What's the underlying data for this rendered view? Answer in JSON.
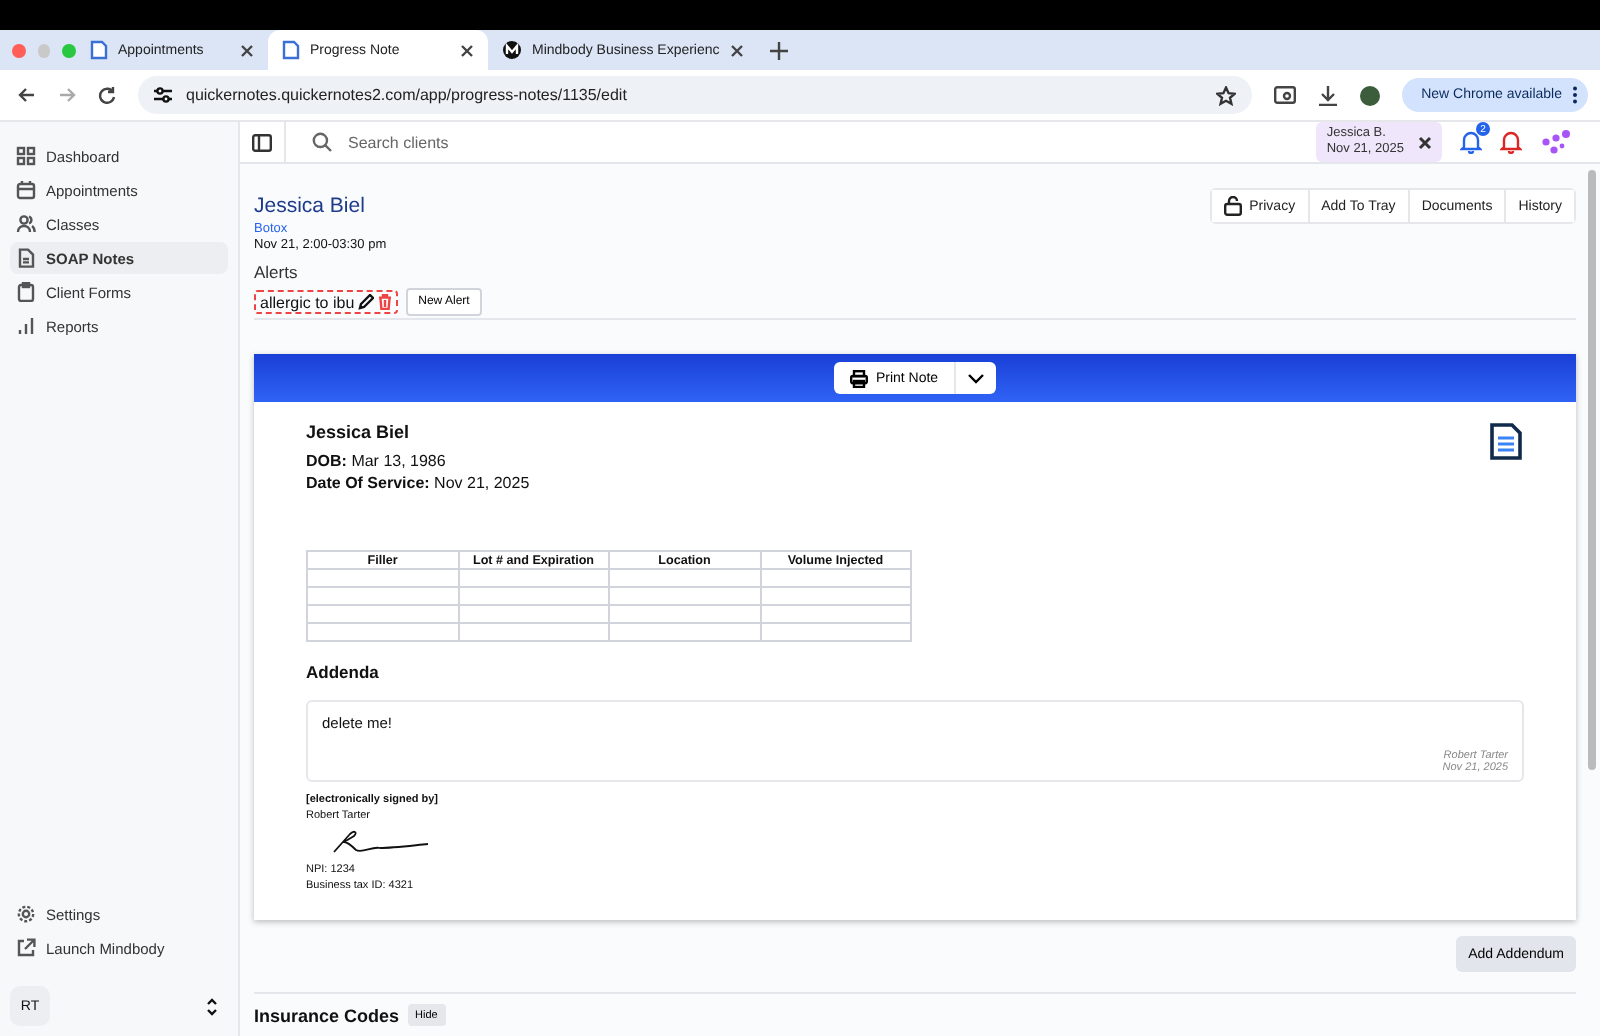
{
  "browser": {
    "tabs": [
      {
        "title": "Appointments",
        "selected": false
      },
      {
        "title": "Progress Note",
        "selected": true
      },
      {
        "title": "Mindbody Business Experienc",
        "selected": false
      }
    ],
    "url": "quickernotes.quickernotes2.com/app/progress-notes/1135/edit",
    "update_button": "New Chrome available"
  },
  "sidebar": {
    "items": [
      {
        "label": "Dashboard",
        "selected": false
      },
      {
        "label": "Appointments",
        "selected": false
      },
      {
        "label": "Classes",
        "selected": false
      },
      {
        "label": "SOAP Notes",
        "selected": true
      },
      {
        "label": "Client Forms",
        "selected": false
      },
      {
        "label": "Reports",
        "selected": false
      }
    ],
    "footer_items": [
      "Settings",
      "Launch Mindbody"
    ],
    "user_initials": "RT"
  },
  "header": {
    "search": {
      "placeholder": "Search clients"
    },
    "tray_chip": {
      "name": "Jessica B.",
      "date": "Nov 21, 2025"
    },
    "notification_count": "2"
  },
  "client": {
    "name": "Jessica Biel",
    "service": "Botox",
    "time": "Nov 21, 2:00-03:30 pm"
  },
  "actions": [
    "Privacy",
    "Add To Tray",
    "Documents",
    "History"
  ],
  "alerts": {
    "heading": "Alerts",
    "items": [
      "allergic to ibu"
    ],
    "new_button": "New Alert"
  },
  "note": {
    "print_button": "Print Note",
    "patient": "Jessica Biel",
    "dob_label": "DOB:",
    "dob": "Mar 13, 1986",
    "service_label": "Date Of Service:",
    "service_date": "Nov 21, 2025",
    "table": {
      "columns": [
        "Filler",
        "Lot # and Expiration",
        "Location",
        "Volume Injected"
      ]
    },
    "addenda_heading": "Addenda",
    "addenda": [
      {
        "text": "delete me!",
        "author": "Robert Tarter",
        "date": "Nov 21, 2025"
      }
    ],
    "signed_label": "[electronically signed by]",
    "signer": "Robert Tarter",
    "npi": "NPI: 1234",
    "tax_id": "Business tax ID: 4321"
  },
  "add_addendum_button": "Add Addendum",
  "insurance": {
    "heading": "Insurance Codes",
    "toggle": "Hide"
  }
}
